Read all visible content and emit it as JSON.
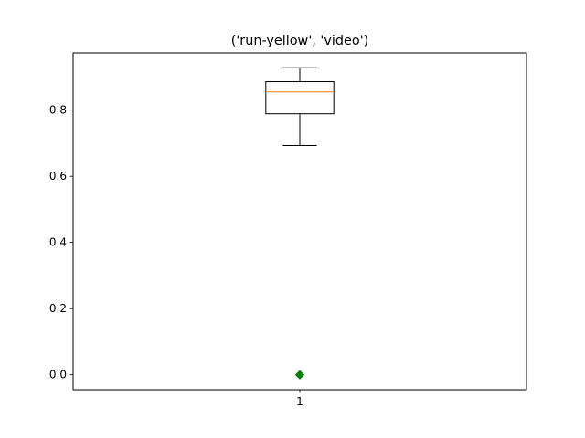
{
  "chart_data": {
    "type": "box",
    "title": "('run-yellow', 'video')",
    "xlabel": "",
    "ylabel": "",
    "categories": [
      "1"
    ],
    "boxes": [
      {
        "name": "1",
        "whisker_low": 0.693,
        "q1": 0.789,
        "median": 0.855,
        "q3": 0.886,
        "whisker_high": 0.928,
        "outliers": [
          0.0
        ]
      }
    ],
    "ylim": [
      -0.045,
      0.973
    ],
    "xlim": [
      0.5,
      1.5
    ],
    "yticks": [
      0.0,
      0.2,
      0.4,
      0.6,
      0.8
    ],
    "ytick_labels": [
      "0.0",
      "0.2",
      "0.4",
      "0.6",
      "0.8"
    ],
    "grid": false,
    "colors": {
      "box": "#000000",
      "median": "#ff7f0e",
      "outlier": "#008000"
    }
  }
}
